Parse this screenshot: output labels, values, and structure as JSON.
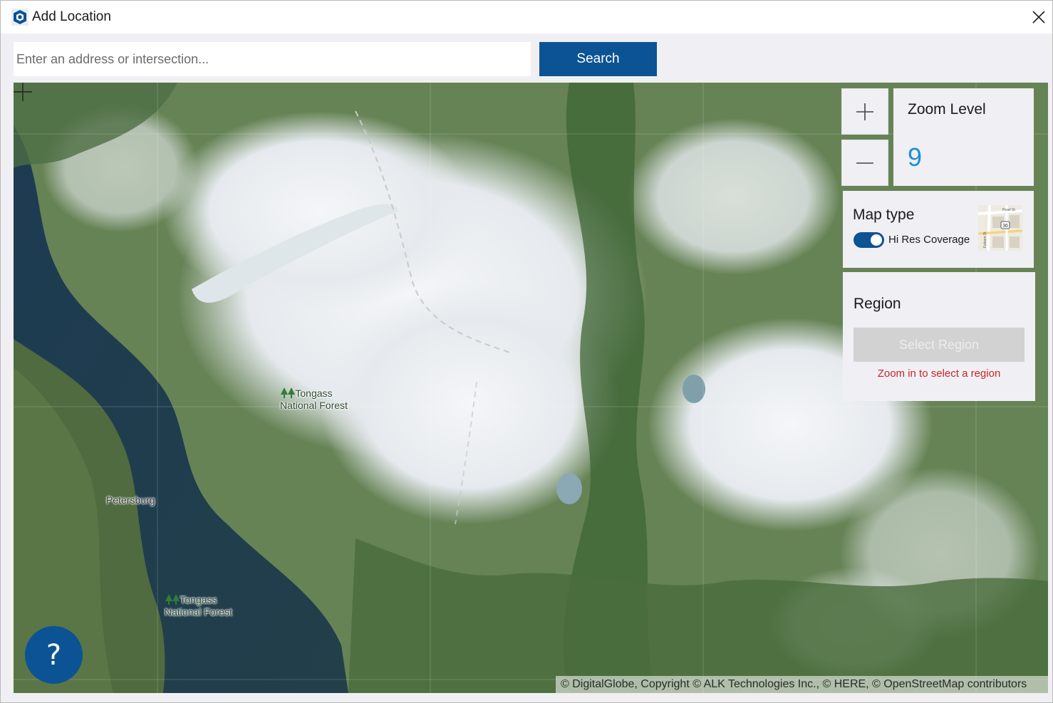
{
  "window": {
    "title": "Add Location",
    "close_glyph": "✕"
  },
  "search": {
    "placeholder": "Enter an address or intersection...",
    "value": "",
    "button_label": "Search"
  },
  "map": {
    "labels": {
      "forest_north": [
        "Tongass",
        "National Forest"
      ],
      "forest_south": [
        "Tongass",
        "National Forest"
      ],
      "city": "Petersburg"
    },
    "attribution": "© DigitalGlobe, Copyright © ALK Technologies Inc., © HERE, © OpenStreetMap contributors"
  },
  "zoom": {
    "in_icon": "plus-icon",
    "out_icon": "minus-icon",
    "title": "Zoom Level",
    "value": "9"
  },
  "map_type": {
    "title": "Map type",
    "toggle_label": "Hi Res Coverage",
    "toggle_on": true,
    "thumbnail_street_labels": [
      "Pearl St",
      "Folsom St",
      "36"
    ]
  },
  "region": {
    "title": "Region",
    "button_label": "Select Region",
    "hint": "Zoom in to select a region",
    "hint_color": "#c62828"
  },
  "help": {
    "label": "?"
  },
  "colors": {
    "accent": "#0b5394",
    "zoom_value": "#1a8fd6"
  }
}
